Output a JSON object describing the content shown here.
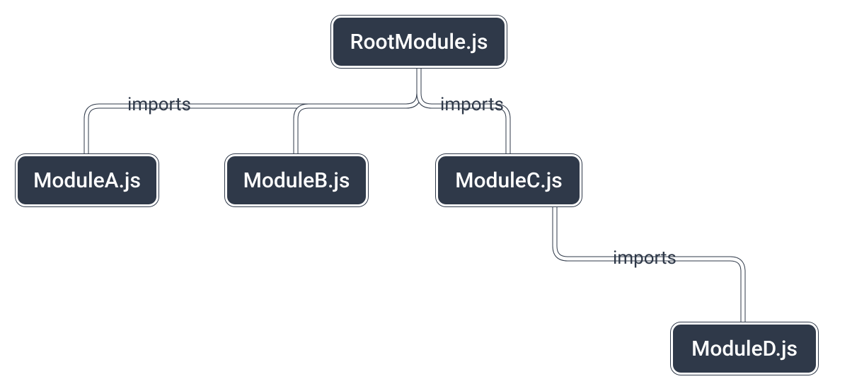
{
  "diagram": {
    "type": "tree",
    "root": {
      "label": "RootModule.js",
      "edge_label": "imports",
      "children": [
        {
          "label": "ModuleA.js"
        },
        {
          "label": "ModuleB.js"
        },
        {
          "label": "ModuleC.js",
          "edge_label": "imports",
          "children": [
            {
              "label": "ModuleD.js"
            }
          ]
        }
      ]
    }
  },
  "labels": {
    "root": "RootModule.js",
    "a": "ModuleA.js",
    "b": "ModuleB.js",
    "c": "ModuleC.js",
    "d": "ModuleD.js",
    "edge_root_left": "imports",
    "edge_root_right": "imports",
    "edge_c_d": "imports"
  },
  "colors": {
    "node_bg": "#2f3949",
    "node_border": "#ffffff",
    "text": "#ffffff",
    "connector": "#ffffff",
    "label": "#2f3949"
  }
}
